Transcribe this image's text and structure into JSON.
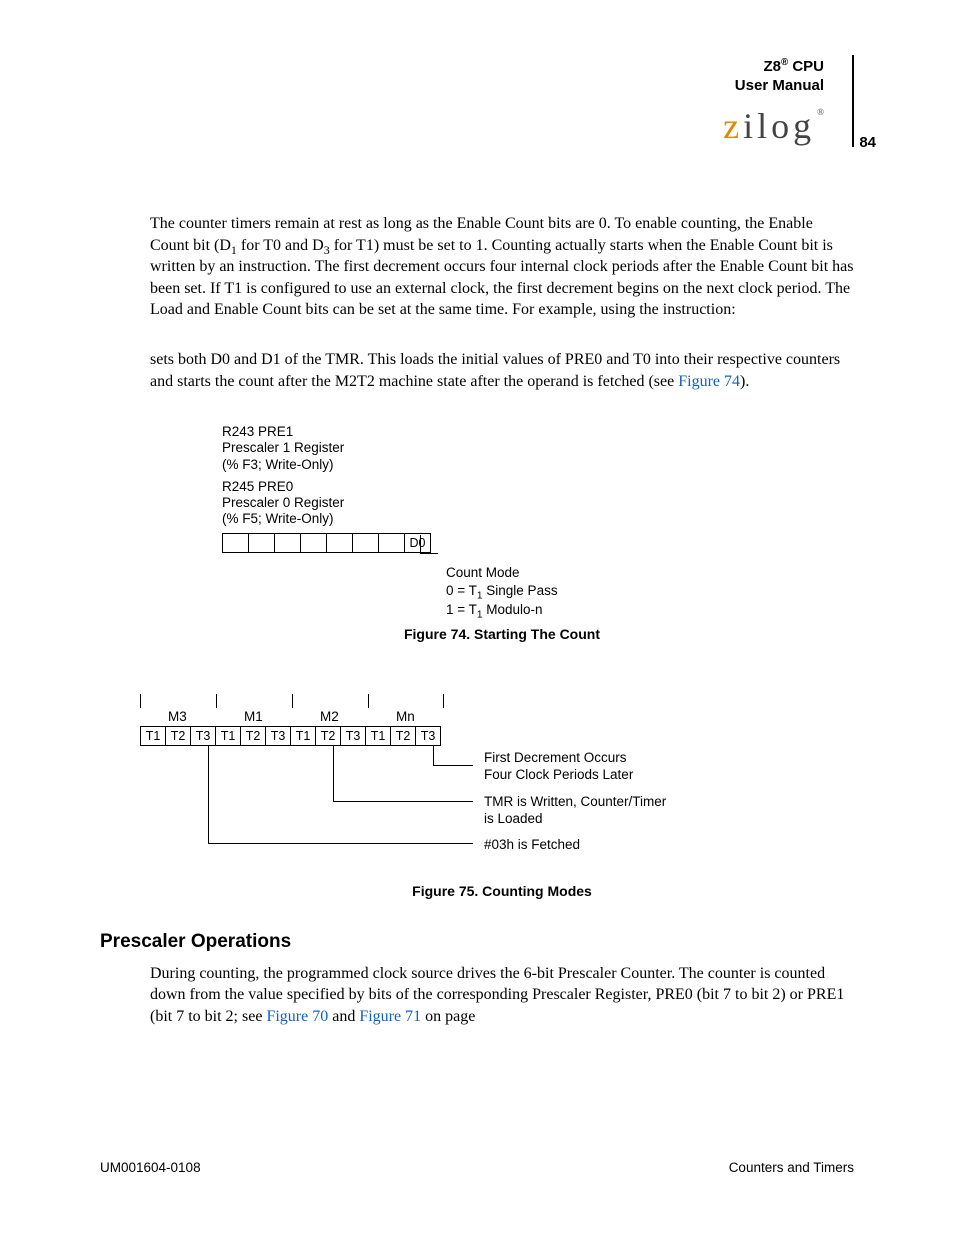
{
  "header": {
    "product_pre": "Z8",
    "product_reg": "®",
    "product_post": " CPU",
    "subtitle": "User Manual",
    "logo_z": "z",
    "logo_rest": "ilog",
    "logo_reg": "®",
    "page_number": "84"
  },
  "para1": {
    "a": "The counter timers remain at rest as long as the Enable Count bits are 0. To enable counting, the Enable Count bit (D",
    "sub1": "1",
    "b": " for T0 and D",
    "sub2": "3",
    "c": " for T1) must be set to 1. Counting actually starts when the Enable Count bit is written by an instruction. The first decrement occurs four internal clock periods after the Enable Count bit has been set. If T1 is configured to use an external clock, the first decrement begins on the next clock period. The Load and Enable Count bits can be set at the same time. For example, using the instruction:"
  },
  "para2": {
    "a": "sets both D0 and D1 of the TMR. This loads the initial values of PRE0 and T0 into their respective counters and starts the count after the M2T2 machine state after the operand is fetched (see ",
    "link": "Figure 74",
    "b": ")."
  },
  "fig74": {
    "reg1_line1": "R243 PRE1",
    "reg1_line2": "Prescaler 1 Register",
    "reg1_line3": "(% F3; Write-Only)",
    "reg2_line1": "R245 PRE0",
    "reg2_line2": "Prescaler 0 Register",
    "reg2_line3": "(% F5; Write-Only)",
    "bit_label": "D0",
    "mode_title": "Count Mode",
    "mode0_a": "0 = T",
    "mode0_sub": "1",
    "mode0_b": " Single Pass",
    "mode1_a": "1 = T",
    "mode1_sub": "1",
    "mode1_b": "  Modulo-n",
    "caption": "Figure 74. Starting The Count"
  },
  "fig75": {
    "m_labels": [
      "M3",
      "M1",
      "M2",
      "Mn"
    ],
    "t_labels": [
      "T1",
      "T2",
      "T3",
      "T1",
      "T2",
      "T3",
      "T1",
      "T2",
      "T3",
      "T1",
      "T2",
      "T3"
    ],
    "note1_a": "First Decrement Occurs",
    "note1_b": "Four Clock Periods Later",
    "note2_a": "TMR is Written, Counter/Timer",
    "note2_b": "is Loaded",
    "note3": "#03h is Fetched",
    "caption": "Figure 75. Counting Modes"
  },
  "section_heading": "Prescaler Operations",
  "para3": {
    "a": "During counting, the programmed clock source drives the 6-bit Prescaler Counter. The counter is counted down from the value specified by bits of the corresponding Prescaler Register, PRE0 (bit 7 to bit 2) or PRE1 (bit 7 to bit 2; see ",
    "link1": "Figure 70",
    "mid": " and ",
    "link2": "Figure 71",
    "b": " on page"
  },
  "footer": {
    "left": "UM001604-0108",
    "right": "Counters and Timers"
  }
}
